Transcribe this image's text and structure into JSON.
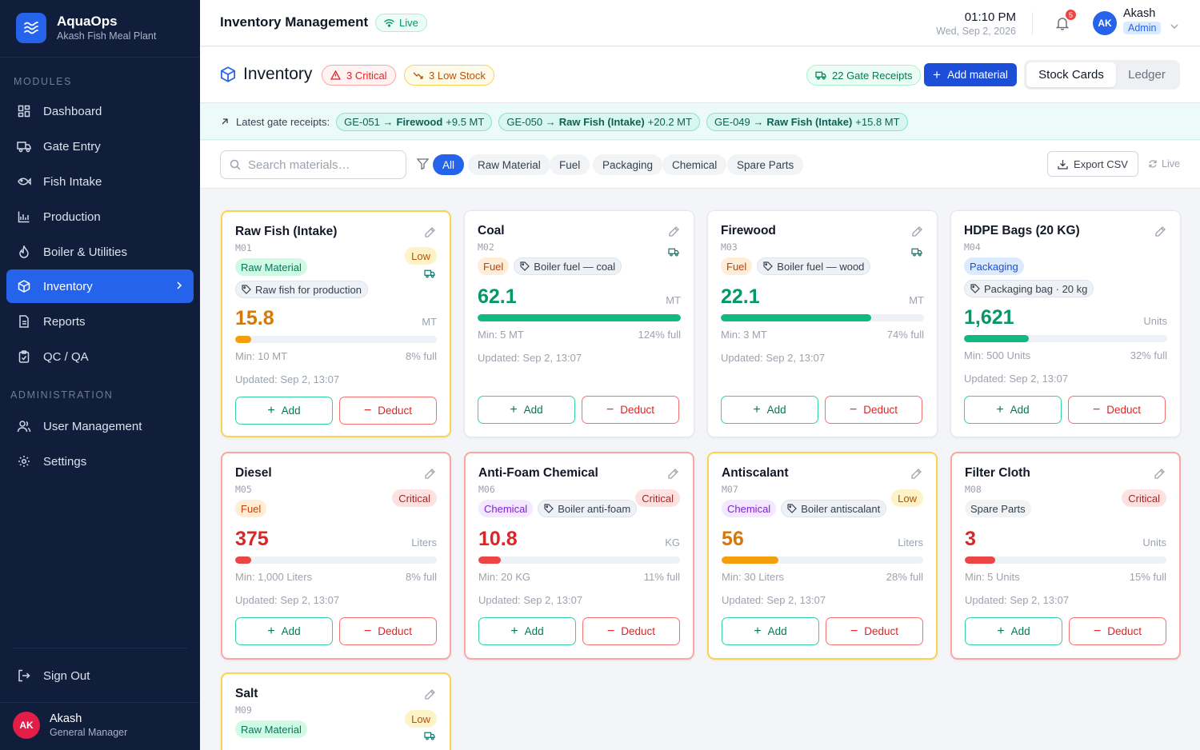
{
  "sidebar": {
    "brand_name": "AquaOps",
    "brand_sub": "Akash Fish Meal Plant",
    "modules_label": "MODULES",
    "admin_label": "ADMINISTRATION",
    "items": [
      {
        "label": "Dashboard",
        "icon": "dashboard-icon"
      },
      {
        "label": "Gate Entry",
        "icon": "truck-icon"
      },
      {
        "label": "Fish Intake",
        "icon": "fish-icon"
      },
      {
        "label": "Production",
        "icon": "chart-icon"
      },
      {
        "label": "Boiler & Utilities",
        "icon": "flame-icon"
      },
      {
        "label": "Inventory",
        "icon": "box-icon"
      },
      {
        "label": "Reports",
        "icon": "document-icon"
      },
      {
        "label": "QC / QA",
        "icon": "clipboard-icon"
      }
    ],
    "admin_items": [
      {
        "label": "User Management",
        "icon": "users-icon"
      },
      {
        "label": "Settings",
        "icon": "gear-icon"
      }
    ],
    "sign_out": "Sign Out",
    "user": {
      "initials": "AK",
      "name": "Akash",
      "role": "General Manager"
    }
  },
  "topbar": {
    "title": "Inventory Management",
    "live": "Live",
    "time": "01:10 PM",
    "date": "Wed, Sep 2, 2026",
    "notif_count": "5",
    "user_initials": "AK",
    "user_name": "Akash",
    "user_role": "Admin"
  },
  "header": {
    "title": "Inventory",
    "critical_badge": "3 Critical",
    "low_badge": "3 Low Stock",
    "gate_receipts": "22 Gate Receipts",
    "add_material": "Add material",
    "view_tabs": [
      "Stock Cards",
      "Ledger"
    ]
  },
  "receipts": {
    "label": "Latest gate receipts:",
    "items": [
      {
        "id": "GE-051 →",
        "material": "Firewood",
        "qty": "+9.5 MT"
      },
      {
        "id": "GE-050 →",
        "material": "Raw Fish (Intake)",
        "qty": "+20.2 MT"
      },
      {
        "id": "GE-049 →",
        "material": "Raw Fish (Intake)",
        "qty": "+15.8 MT"
      }
    ]
  },
  "filters": {
    "search_placeholder": "Search materials…",
    "categories": [
      "All",
      "Raw Material",
      "Fuel",
      "Packaging",
      "Chemical",
      "Spare Parts"
    ],
    "export": "Export CSV",
    "live": "Live"
  },
  "actions": {
    "add": "Add",
    "deduct": "Deduct"
  },
  "colors": {
    "accent": "#2563eb",
    "ok": "#10b981",
    "warn": "#f59e0b",
    "crit": "#ef4444",
    "sidebar": "#101d3b"
  },
  "materials": [
    {
      "name": "Raw Fish (Intake)",
      "code": "M01",
      "category": "Raw Material",
      "note": "Raw fish for production",
      "status": "Low",
      "qty": "15.8",
      "unit": "MT",
      "min": "Min: 10 MT",
      "pct_label": "8% full",
      "fill": 0.08,
      "updated": "Updated: Sep 2, 13:07"
    },
    {
      "name": "Coal",
      "code": "M02",
      "category": "Fuel",
      "note": "Boiler fuel — coal",
      "status": "",
      "qty": "62.1",
      "unit": "MT",
      "min": "Min: 5 MT",
      "pct_label": "124% full",
      "fill": 1.0,
      "updated": "Updated: Sep 2, 13:07"
    },
    {
      "name": "Firewood",
      "code": "M03",
      "category": "Fuel",
      "note": "Boiler fuel — wood",
      "status": "",
      "qty": "22.1",
      "unit": "MT",
      "min": "Min: 3 MT",
      "pct_label": "74% full",
      "fill": 0.74,
      "updated": "Updated: Sep 2, 13:07"
    },
    {
      "name": "HDPE Bags (20 KG)",
      "code": "M04",
      "category": "Packaging",
      "note": "Packaging bag · 20 kg",
      "status": "",
      "qty": "1,621",
      "unit": "Units",
      "min": "Min: 500 Units",
      "pct_label": "32% full",
      "fill": 0.32,
      "updated": "Updated: Sep 2, 13:07"
    },
    {
      "name": "Diesel",
      "code": "M05",
      "category": "Fuel",
      "note": "",
      "status": "Critical",
      "qty": "375",
      "unit": "Liters",
      "min": "Min: 1,000 Liters",
      "pct_label": "8% full",
      "fill": 0.08,
      "updated": "Updated: Sep 2, 13:07"
    },
    {
      "name": "Anti-Foam Chemical",
      "code": "M06",
      "category": "Chemical",
      "note": "Boiler anti-foam",
      "status": "Critical",
      "qty": "10.8",
      "unit": "KG",
      "min": "Min: 20 KG",
      "pct_label": "11% full",
      "fill": 0.11,
      "updated": "Updated: Sep 2, 13:07"
    },
    {
      "name": "Antiscalant",
      "code": "M07",
      "category": "Chemical",
      "note": "Boiler antiscalant",
      "status": "Low",
      "qty": "56",
      "unit": "Liters",
      "min": "Min: 30 Liters",
      "pct_label": "28% full",
      "fill": 0.28,
      "updated": "Updated: Sep 2, 13:07"
    },
    {
      "name": "Filter Cloth",
      "code": "M08",
      "category": "Spare Parts",
      "note": "",
      "status": "Critical",
      "qty": "3",
      "unit": "Units",
      "min": "Min: 5 Units",
      "pct_label": "15% full",
      "fill": 0.15,
      "updated": "Updated: Sep 2, 13:07"
    },
    {
      "name": "Salt",
      "code": "M09",
      "category": "Raw Material",
      "note": "",
      "status": "Low",
      "qty": "",
      "unit": "",
      "min": "",
      "pct_label": "",
      "fill": 0,
      "updated": ""
    }
  ]
}
